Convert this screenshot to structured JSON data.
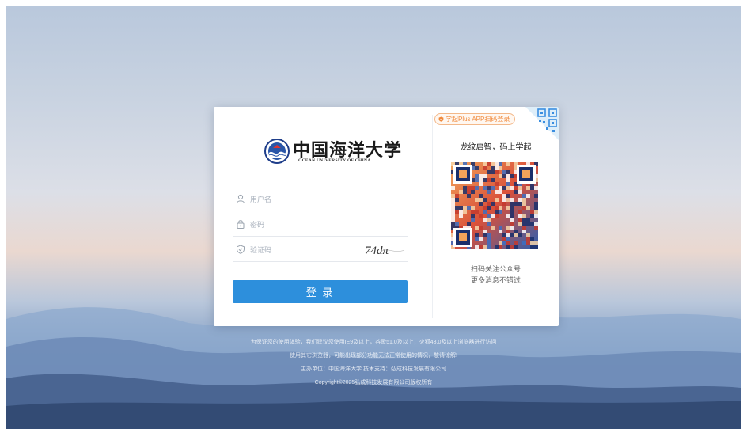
{
  "logo": {
    "name_cn": "中国海洋大学",
    "name_en": "OCEAN UNIVERSITY OF CHINA"
  },
  "form": {
    "username_placeholder": "用户名",
    "password_placeholder": "密码",
    "captcha_placeholder": "验证码",
    "captcha_text": "74dπ",
    "login_label": "登 录"
  },
  "side": {
    "app_tag": "学起Plus APP扫码登录",
    "slogan": "龙纹启智，码上学起",
    "qr_note_1": "扫码关注公众号",
    "qr_note_2": "更多消息不错过"
  },
  "footer": {
    "line1": "为保证您的使用体验，我们建议您使用IE9及以上，谷歌51.0及以上，火狐43.0及以上浏览器进行访问",
    "line2": "使用其它浏览器，可能出现部分功能无法正常使用的情况，敬请谅解!",
    "line3": "主办单位：中国海洋大学  技术支持：弘成科技发展有限公司",
    "line4": "Copyright©2025弘成科技发展有限公司版权所有"
  },
  "colors": {
    "primary": "#2d8fdc",
    "accent_orange": "#f08a3c",
    "qr_corner": "#4a9fe0"
  }
}
